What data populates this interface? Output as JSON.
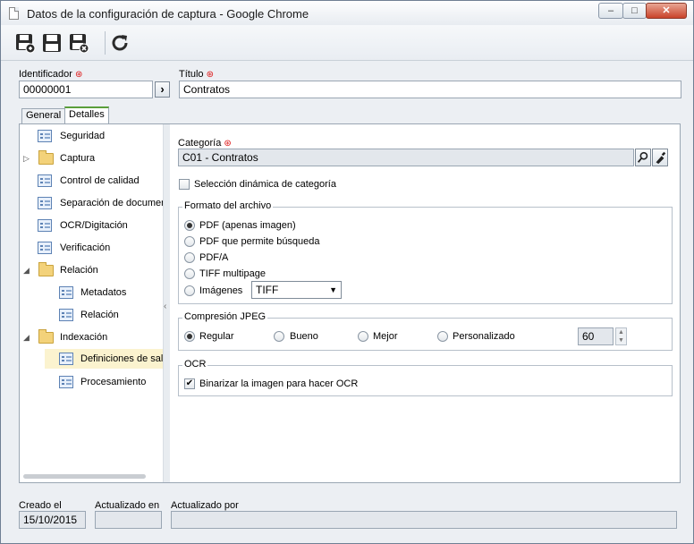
{
  "window": {
    "title": "Datos de la configuración de captura - Google Chrome",
    "min_label": "–",
    "max_label": "□",
    "close_label": "✕"
  },
  "header": {
    "identifier_label": "Identificador",
    "identifier_value": "00000001",
    "title_label": "Título",
    "title_value": "Contratos",
    "required_mark": "⊛"
  },
  "tabs": [
    {
      "label": "General"
    },
    {
      "label": "Detalles"
    }
  ],
  "tree": [
    {
      "label": "Seguridad"
    },
    {
      "label": "Captura"
    },
    {
      "label": "Control de calidad"
    },
    {
      "label": "Separación de documer"
    },
    {
      "label": "OCR/Digitación"
    },
    {
      "label": "Verificación"
    },
    {
      "label": "Relación"
    },
    {
      "label": "Metadatos"
    },
    {
      "label": "Relación"
    },
    {
      "label": "Indexación"
    },
    {
      "label": "Definiciones de sal"
    },
    {
      "label": "Procesamiento"
    }
  ],
  "details": {
    "category_label": "Categoría",
    "category_value": "C01 - Contratos",
    "dynamic_category_label": "Selección dinámica de categoría",
    "file_format": {
      "title": "Formato del archivo",
      "options": [
        "PDF (apenas imagen)",
        "PDF que permite búsqueda",
        "PDF/A",
        "TIFF multipage",
        "Imágenes"
      ],
      "selected": "PDF (apenas imagen)",
      "images_format": "TIFF"
    },
    "jpeg": {
      "title": "Compresión JPEG",
      "options": [
        "Regular",
        "Bueno",
        "Mejor",
        "Personalizado"
      ],
      "selected": "Regular",
      "custom_value": "60"
    },
    "ocr": {
      "title": "OCR",
      "binarize_label": "Binarizar la imagen para hacer OCR",
      "binarize_checked": true
    }
  },
  "footer": {
    "created_label": "Creado el",
    "created_value": "15/10/2015",
    "updated_on_label": "Actualizado en",
    "updated_on_value": "",
    "updated_by_label": "Actualizado por",
    "updated_by_value": ""
  },
  "icons": [
    "save-new-icon",
    "save-icon",
    "save-close-icon",
    "refresh-icon",
    "search-icon",
    "clear-icon"
  ]
}
